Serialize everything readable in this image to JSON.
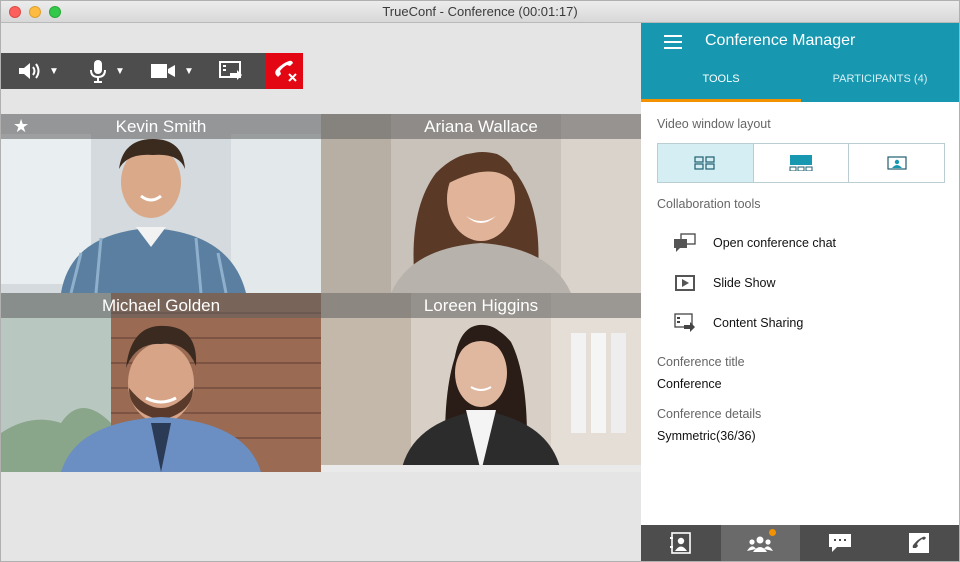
{
  "window": {
    "title": "TrueConf - Conference (00:01:17)"
  },
  "toolbar": {
    "icons": [
      "speaker-icon",
      "microphone-icon",
      "camera-icon",
      "content-share-icon",
      "hangup-icon"
    ],
    "arrow": "▼"
  },
  "participants_video": [
    {
      "name": "Kevin Smith",
      "starred": true,
      "bg": "#c7cfd3",
      "shirt": "#5a7fa0",
      "skin": "#d9a98a",
      "hair": "#3b2a1e"
    },
    {
      "name": "Ariana Wallace",
      "starred": false,
      "bg": "#b8b0a8",
      "shirt": "#b7b2ab",
      "skin": "#e1b49a",
      "hair": "#5a3a26"
    },
    {
      "name": "Michael Golden",
      "starred": false,
      "bg": "#9a6a52",
      "shirt": "#6b8fc2",
      "skin": "#d7a488",
      "hair": "#3a2a20"
    },
    {
      "name": "Loreen Higgins",
      "starred": false,
      "bg": "#cfc6bb",
      "shirt": "#2c2c2c",
      "skin": "#e0b8a0",
      "hair": "#2a1c16"
    }
  ],
  "star": "★",
  "panel": {
    "title": "Conference Manager",
    "tabs": {
      "tools": "TOOLS",
      "participants": "PARTICIPANTS (4)"
    },
    "video_layout_label": "Video window layout",
    "layout_options": [
      "layout-grid-icon",
      "layout-speaker-icon",
      "layout-single-icon"
    ],
    "collaboration_label": "Collaboration tools",
    "tools": [
      {
        "icon": "chat-icon",
        "label": "Open conference chat"
      },
      {
        "icon": "slideshow-icon",
        "label": "Slide Show"
      },
      {
        "icon": "content-sharing-icon",
        "label": "Content Sharing"
      }
    ],
    "conference_title_label": "Conference title",
    "conference_title_value": "Conference",
    "conference_details_label": "Conference details",
    "conference_details_value": "Symmetric(36/36)",
    "bottom_bar": [
      "contacts-icon",
      "participants-icon",
      "chat-icon",
      "call-icon"
    ]
  },
  "colors": {
    "accent": "#1798b0",
    "tab_underline": "#f39200",
    "hangup": "#e30613",
    "toolbar": "#4d4d4d"
  }
}
